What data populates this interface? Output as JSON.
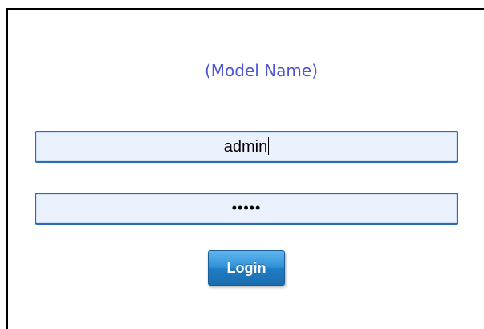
{
  "login": {
    "model_name": "(Model Name)",
    "username_value": "admin",
    "password_masked": "•••••",
    "login_label": "Login"
  },
  "colors": {
    "title": "#4f56d6",
    "field_border": "#2a6db0",
    "field_bg": "#eaf1fd",
    "button": "#2f8fd6"
  }
}
